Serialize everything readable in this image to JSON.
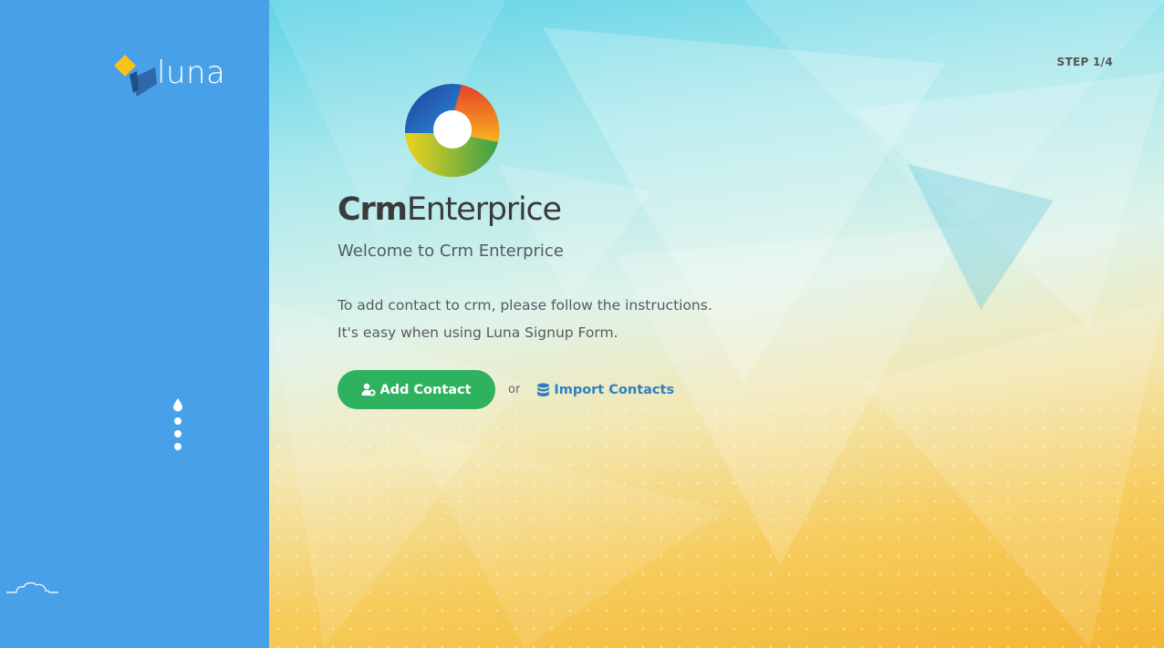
{
  "sidebar": {
    "logo_text": "luna",
    "progress_total": 4,
    "progress_current": 1
  },
  "header": {
    "step_label": "STEP 1/4"
  },
  "brand": {
    "name_bold": "Crm",
    "name_regular": "Enterprice"
  },
  "main": {
    "welcome": "Welcome to Crm Enterprice",
    "instruction_line1": "To add contact to crm, please follow the instructions.",
    "instruction_line2": "It's easy when using Luna Signup Form.",
    "add_contact_label": "Add Contact",
    "or_label": "or",
    "import_contacts_label": "Import Contacts"
  },
  "icons": {
    "logo": "luna-logo-icon",
    "brand": "crm-ring-logo-icon",
    "add_contact": "user-add-icon",
    "import_contacts": "database-icon",
    "cloud": "cloud-icon",
    "progress_current": "droplet-icon"
  },
  "colors": {
    "sidebar": "#48a0e8",
    "button_green": "#2fb25f",
    "link_blue": "#2f7fc4",
    "logo_yellow": "#f6c21b",
    "logo_dark_blue": "#2d6aa8"
  }
}
